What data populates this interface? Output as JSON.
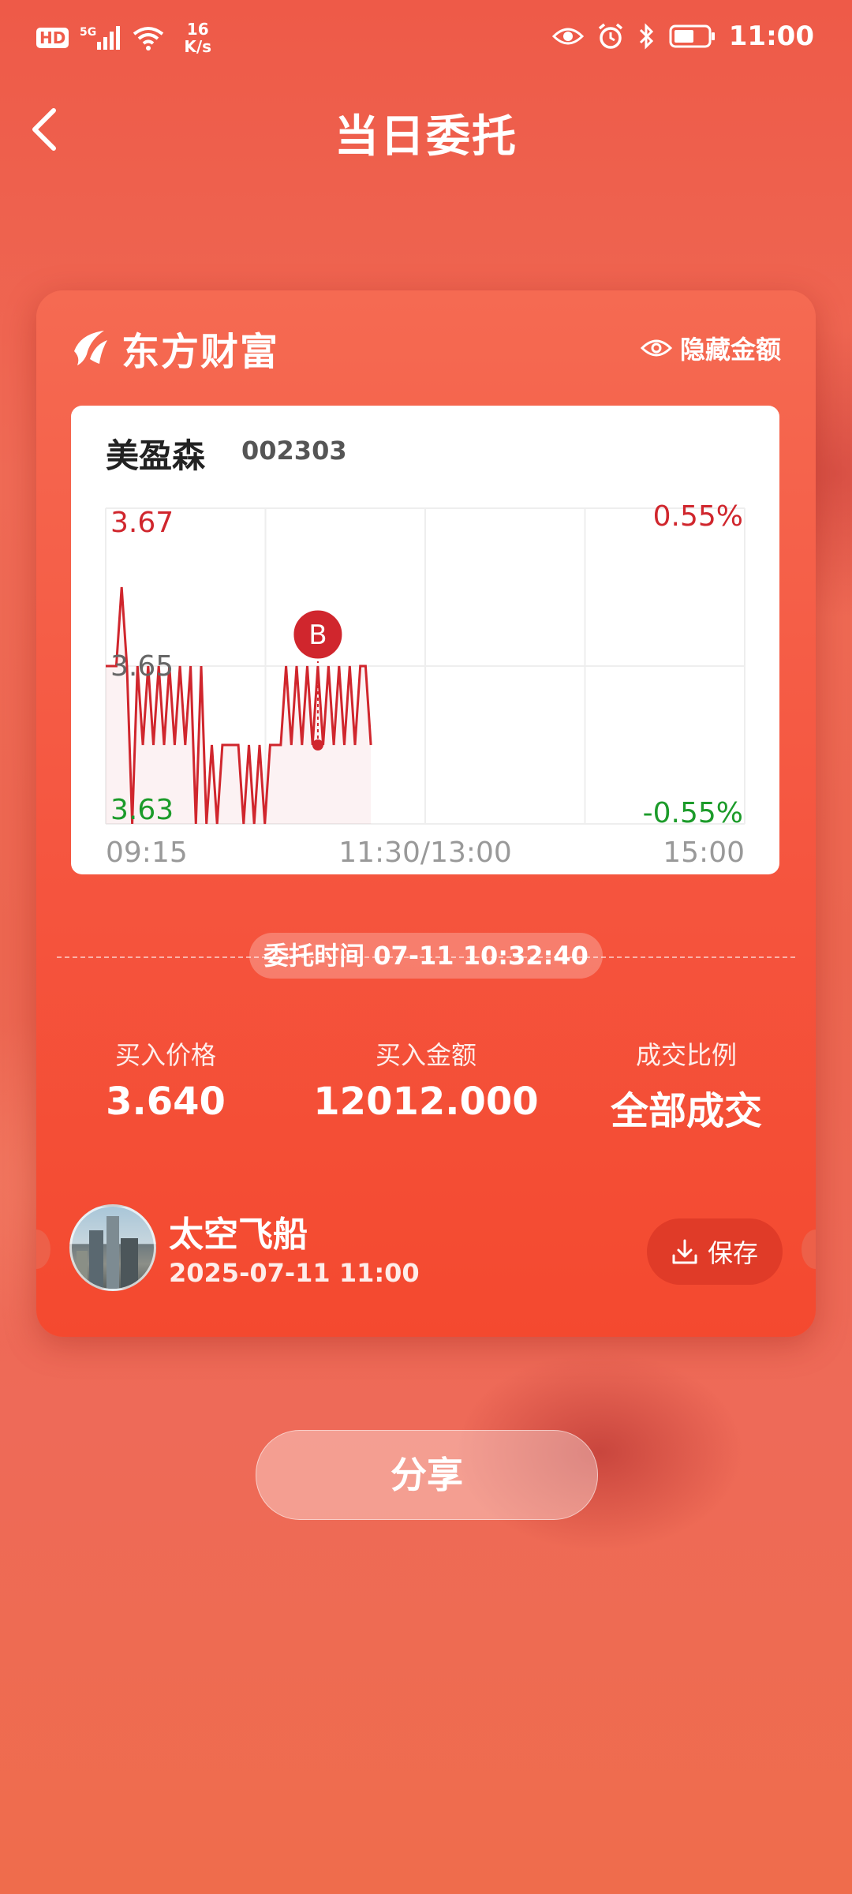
{
  "status_bar": {
    "hd": "HD",
    "network": "5G",
    "speed_value": "16",
    "speed_unit": "K/s",
    "time": "11:00",
    "icons": [
      "eye-icon",
      "alarm-icon",
      "bluetooth-icon",
      "battery-icon"
    ]
  },
  "header": {
    "title": "当日委托"
  },
  "card": {
    "brand": "东方财富",
    "hide_amount_label": "隐藏金额",
    "stock": {
      "name": "美盈森",
      "code": "002303"
    },
    "order_time": "委托时间 07-11 10:32:40",
    "stats": [
      {
        "label": "买入价格",
        "value": "3.640"
      },
      {
        "label": "买入金额",
        "value": "12012.000"
      },
      {
        "label": "成交比例",
        "value": "全部成交"
      }
    ],
    "user": {
      "name": "太空飞船",
      "datetime": "2025-07-11 11:00"
    },
    "save_label": "保存"
  },
  "share_label": "分享",
  "colors": {
    "accent": "#f5553f",
    "up": "#d0262d",
    "down": "#1c9b2a"
  },
  "chart_data": {
    "type": "line",
    "x_ticks": [
      "09:15",
      "11:30/13:00",
      "15:00"
    ],
    "y_left_ticks": [
      "3.67",
      "3.65",
      "3.63"
    ],
    "y_right_ticks": [
      "0.55%",
      "-0.55%"
    ],
    "ylim": [
      3.63,
      3.67
    ],
    "marker": {
      "label": "B",
      "time": "10:32",
      "price": 3.64
    },
    "series": [
      {
        "values": [
          3.65,
          3.65,
          3.65,
          3.66,
          3.65,
          3.63,
          3.65,
          3.64,
          3.65,
          3.64,
          3.65,
          3.64,
          3.65,
          3.64,
          3.65,
          3.64,
          3.65,
          3.63,
          3.65,
          3.63,
          3.64,
          3.63,
          3.64,
          3.64,
          3.64,
          3.64,
          3.63,
          3.64,
          3.63,
          3.64,
          3.63,
          3.64,
          3.64,
          3.64,
          3.65,
          3.64,
          3.65,
          3.64,
          3.65,
          3.64,
          3.65,
          3.64,
          3.65,
          3.64,
          3.65,
          3.64,
          3.65,
          3.64,
          3.65,
          3.65,
          3.64
        ]
      }
    ]
  }
}
